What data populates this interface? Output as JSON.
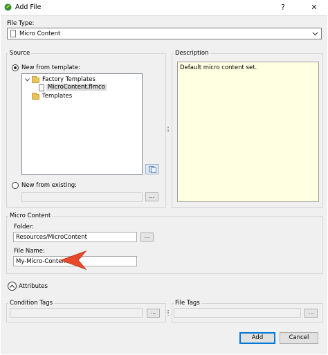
{
  "window": {
    "title": "Add File",
    "help_glyph": "?",
    "close_glyph": "✕"
  },
  "file_type": {
    "label": "File Type:",
    "value": "Micro Content"
  },
  "source": {
    "group_label": "Source",
    "new_from_template": "New from template:",
    "tree": {
      "factory_templates": "Factory Templates",
      "selected_item": "MicroContent.flmco",
      "templates": "Templates"
    },
    "new_from_existing": "New from existing:",
    "browse_label": "..."
  },
  "description": {
    "group_label": "Description",
    "text": "Default micro content set."
  },
  "micro_content": {
    "group_label": "Micro Content",
    "folder_label": "Folder:",
    "folder_value": "Resources/MicroContent",
    "browse_label": "...",
    "file_name_label": "File Name:",
    "file_name_value": "My-Micro-Content"
  },
  "attributes": {
    "label": "Attributes"
  },
  "condition_tags": {
    "label": "Condition Tags",
    "browse_label": "..."
  },
  "file_tags": {
    "label": "File Tags",
    "browse_label": "..."
  },
  "buttons": {
    "add": "Add",
    "cancel": "Cancel"
  },
  "colors": {
    "callout_arrow": "#e8492a",
    "description_bg": "#ffffe1",
    "default_button_border": "#0078d7"
  }
}
